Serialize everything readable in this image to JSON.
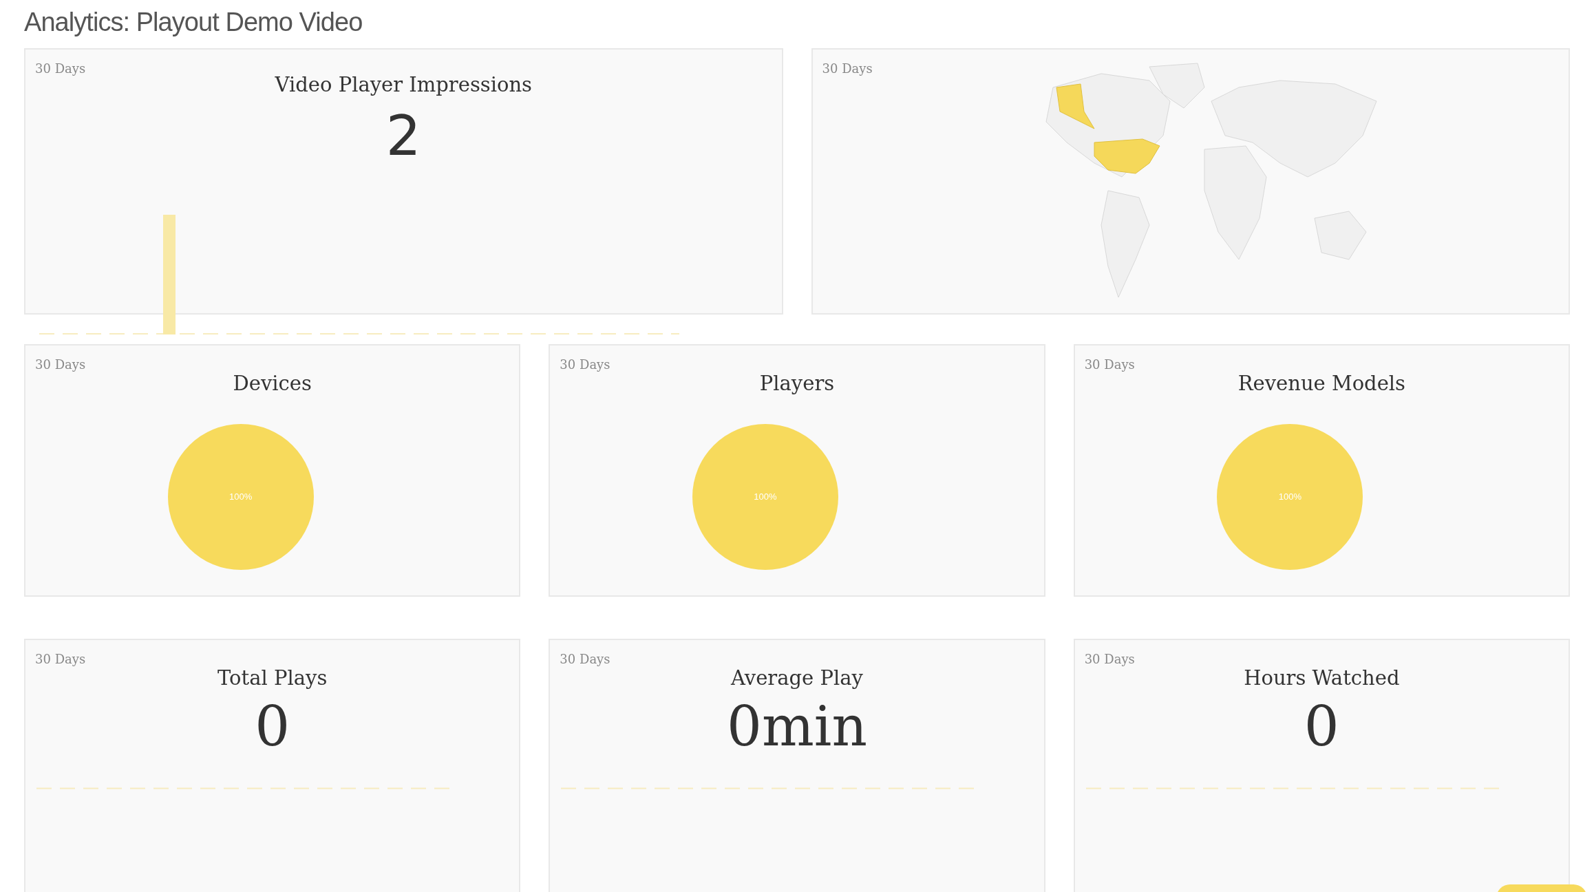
{
  "page_title": "Analytics: Playout Demo Video",
  "impressions": {
    "period": "30 Days",
    "title": "Video Player Impressions",
    "value": "2"
  },
  "map": {
    "period": "30 Days"
  },
  "pie_cards": [
    {
      "period": "30 Days",
      "title": "Devices",
      "label": "100%"
    },
    {
      "period": "30 Days",
      "title": "Players",
      "label": "100%"
    },
    {
      "period": "30 Days",
      "title": "Revenue Models",
      "label": "100%"
    }
  ],
  "stat_cards": [
    {
      "period": "30 Days",
      "title": "Total Plays",
      "value": "0"
    },
    {
      "period": "30 Days",
      "title": "Average Play",
      "value": "0min"
    },
    {
      "period": "30 Days",
      "title": "Hours Watched",
      "value": "0"
    }
  ]
}
